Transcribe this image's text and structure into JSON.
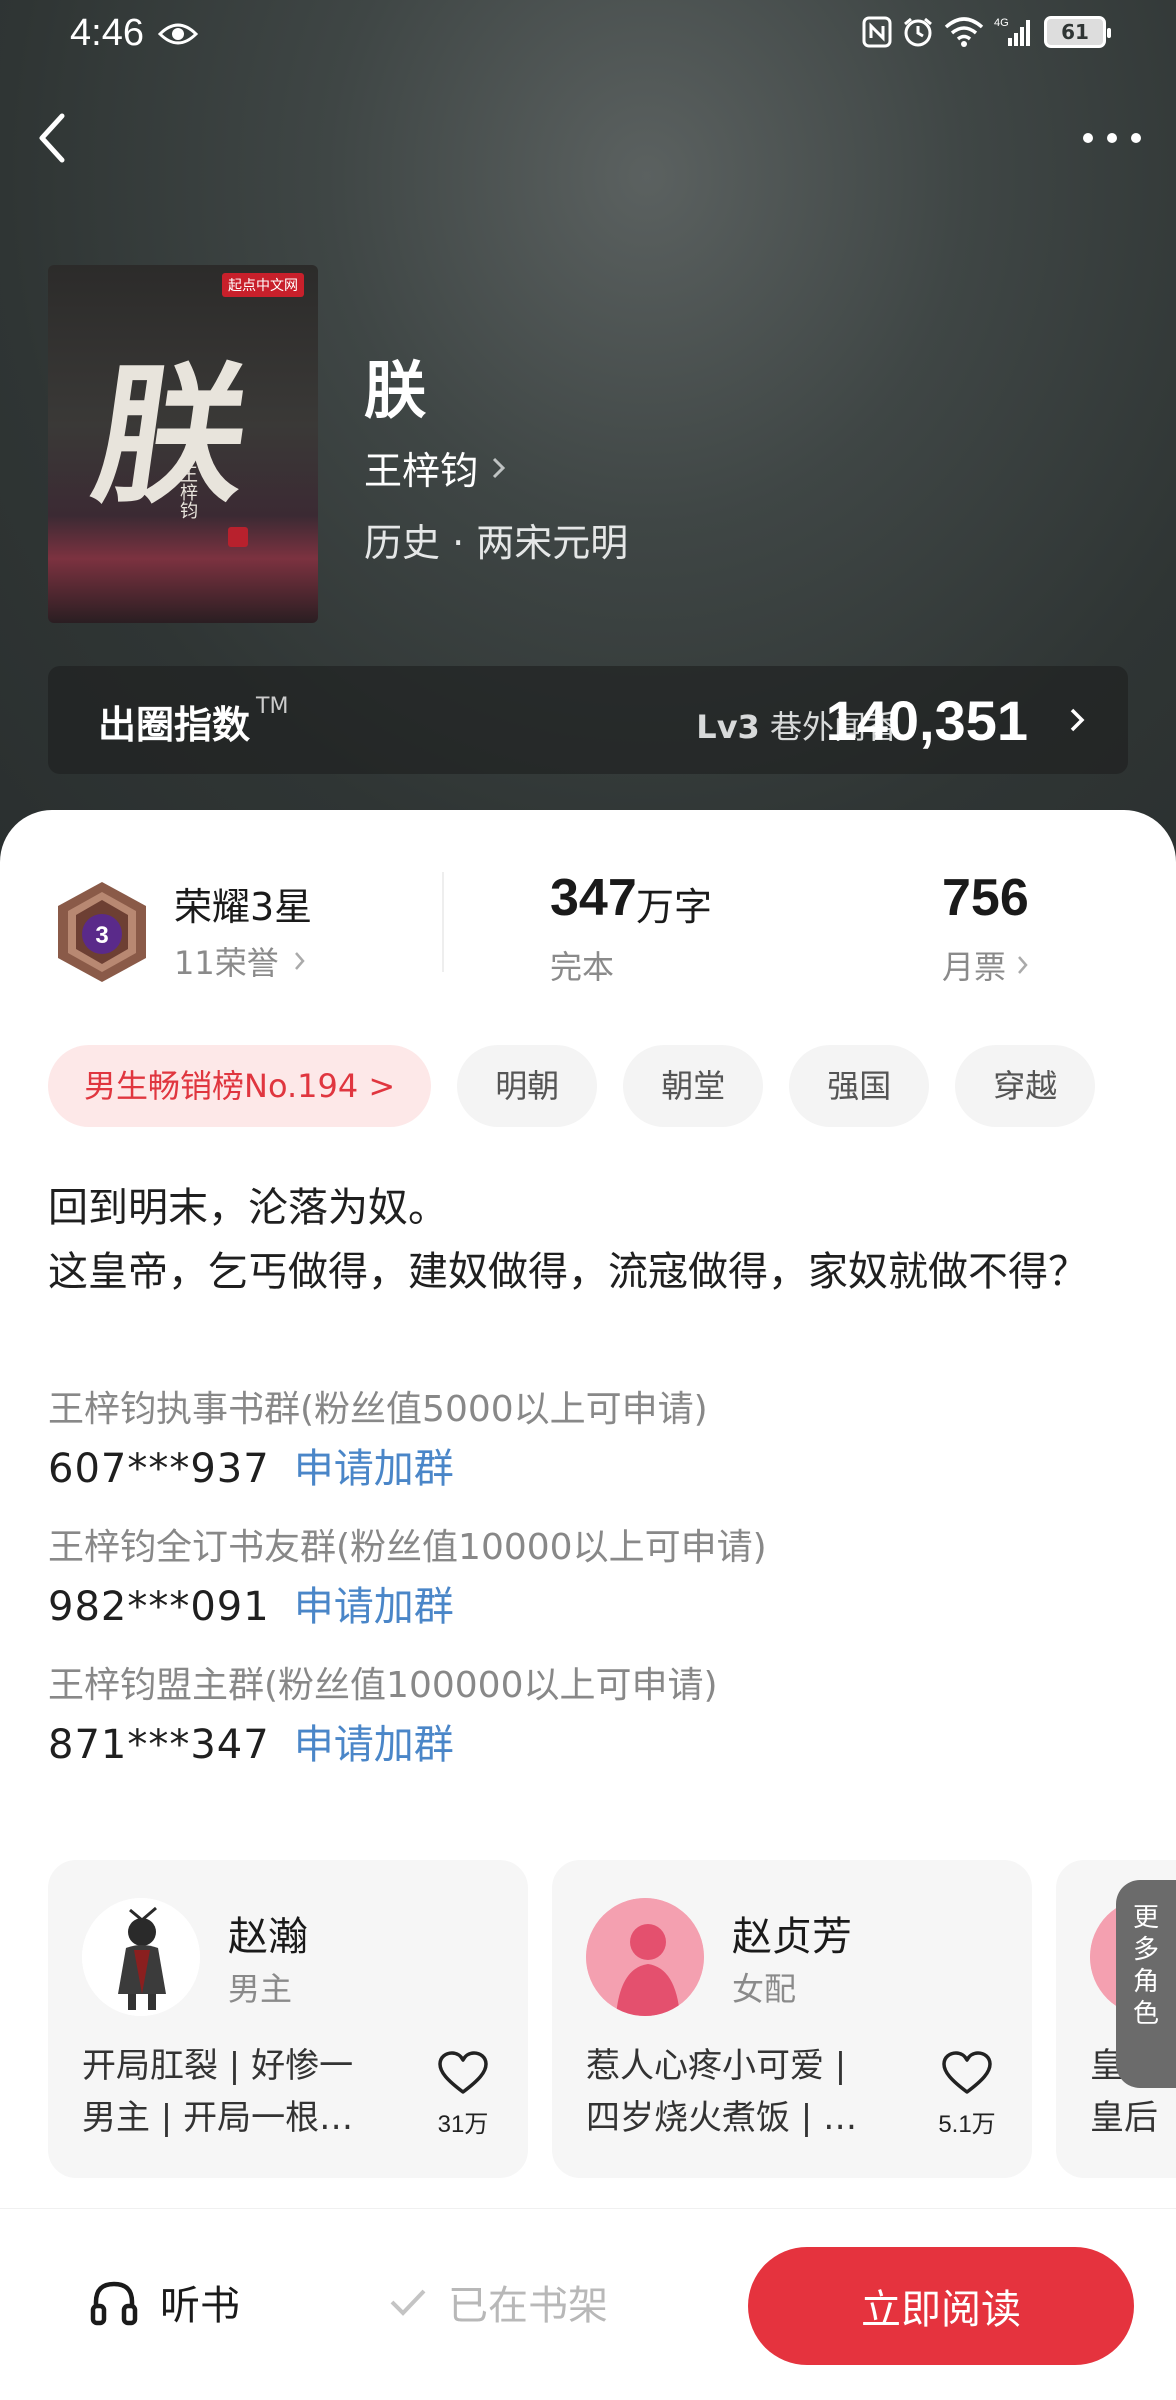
{
  "status_bar": {
    "time": "4:46",
    "battery": "61",
    "network": "4G"
  },
  "book": {
    "title": "朕",
    "author": "王梓钧",
    "genre": "历史 · 两宋元明",
    "cover_char": "朕",
    "cover_logo": "起点中文网"
  },
  "index": {
    "label": "出圈指数",
    "tm": "TM",
    "level_prefix": "Lv3",
    "level_name": "巷外闻香",
    "value": "140,351"
  },
  "stats": {
    "honor_badge_num": "3",
    "honor_title": "荣耀3星",
    "honor_sub": "11荣誉",
    "words_num": "347",
    "words_unit": "万字",
    "status": "完本",
    "votes": "756",
    "votes_label": "月票"
  },
  "tags": [
    "男生畅销榜No.194 >",
    "明朝",
    "朝堂",
    "强国",
    "穿越"
  ],
  "intro": {
    "line1": "回到明末，沦落为奴。",
    "line2": "这皇帝，乞丐做得，建奴做得，流寇做得，家奴就做不得？"
  },
  "groups": [
    {
      "desc": "王梓钧执事书群(粉丝值5000以上可申请)",
      "number": "607***937",
      "link": "申请加群"
    },
    {
      "desc": "王梓钧全订书友群(粉丝值10000以上可申请)",
      "number": "982***091",
      "link": "申请加群"
    },
    {
      "desc": "王梓钧盟主群(粉丝值100000以上可申请)",
      "number": "871***347",
      "link": "申请加群"
    }
  ],
  "characters": [
    {
      "name": "赵瀚",
      "role": "男主",
      "desc1": "开局肛裂 | 好惨一",
      "desc2": "男主 | 开局一根…",
      "likes": "31万"
    },
    {
      "name": "赵贞芳",
      "role": "女配",
      "desc1": "惹人心疼小可爱 |",
      "desc2": "四岁烧火煮饭 | …",
      "likes": "5.1万"
    },
    {
      "name": "",
      "role": "",
      "desc1": "皇后",
      "desc2": "皇后",
      "likes": ""
    }
  ],
  "more_roles": "更多角色",
  "bottom": {
    "listen": "听书",
    "shelf": "已在书架",
    "read": "立即阅读"
  },
  "colors": {
    "accent": "#e5333e",
    "link": "#4a86c8",
    "hero_bg": "#3a4040"
  }
}
